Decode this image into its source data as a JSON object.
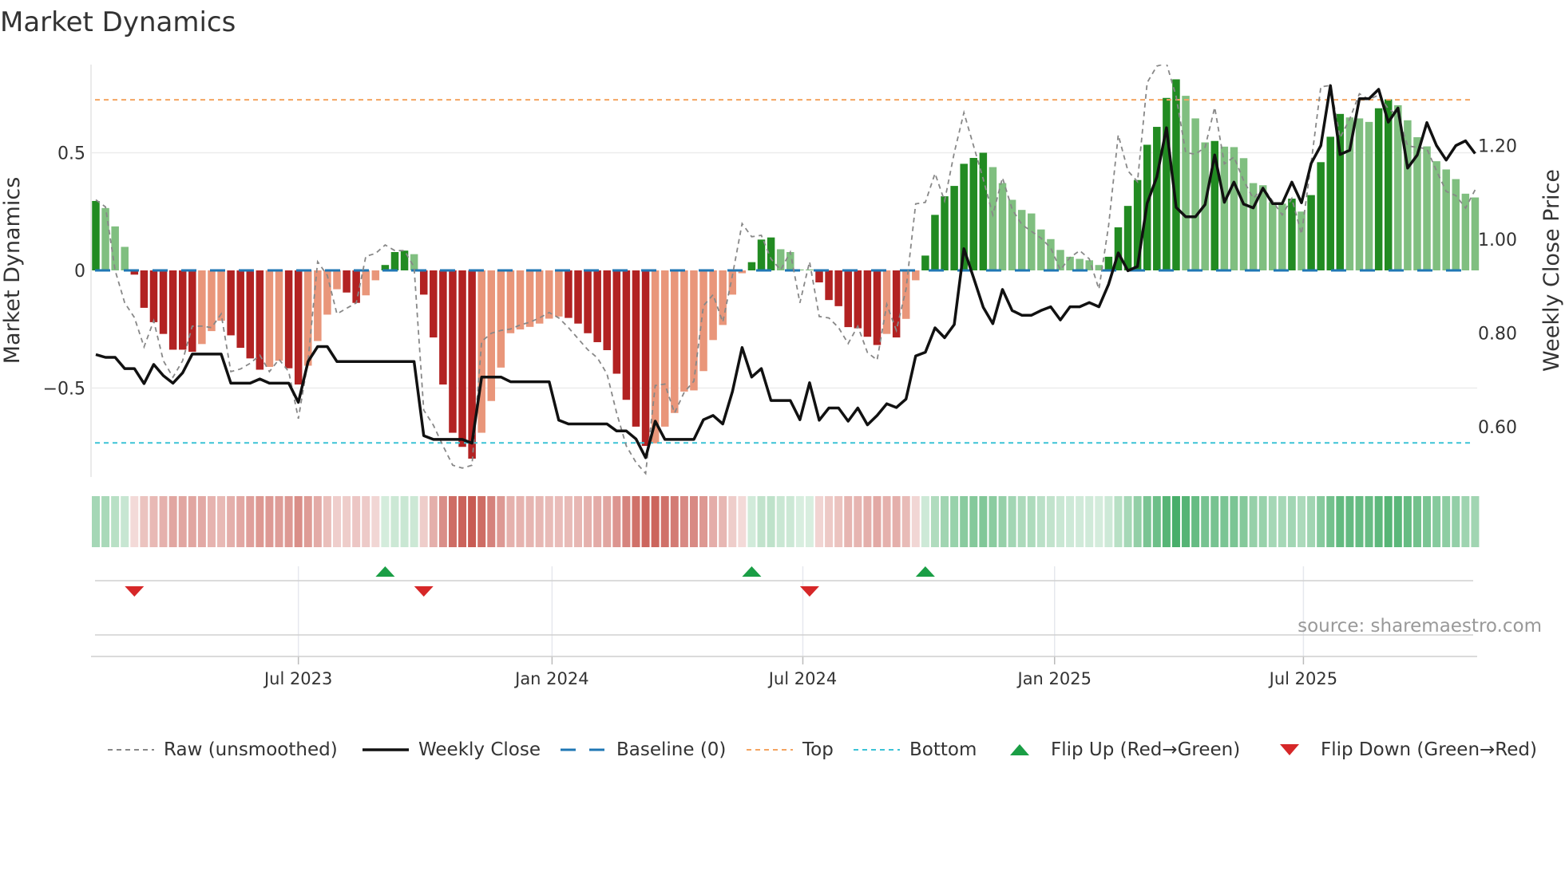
{
  "title": "Market Dynamics",
  "source": "source: sharemaestro.com",
  "colors": {
    "strong_green": "#228b22",
    "weak_green": "#80bf80",
    "strong_red": "#b22222",
    "weak_red": "#e9967a",
    "top": "#f4a460",
    "bottom": "#3cc3d6",
    "baseline": "#1f77b4",
    "raw": "#888888",
    "close": "#111111",
    "flip_up": "#1a9e45",
    "flip_down": "#d62728",
    "strip_green": [
      40,
      160,
      80
    ],
    "strip_red": [
      190,
      60,
      50
    ]
  },
  "chart_data": {
    "type": "bar",
    "title": "Market Dynamics",
    "ylabel": "Market Dynamics",
    "y2label": "Weekly Close Price",
    "ylim": [
      -0.878,
      0.875
    ],
    "y2lim": [
      0.494,
      1.372
    ],
    "grid": true,
    "yticks": [
      {
        "value": 0.5,
        "label": "0.5"
      },
      {
        "value": 0,
        "label": "0"
      },
      {
        "value": -0.5,
        "label": "−0.5"
      }
    ],
    "y2ticks": [
      {
        "value": 1.2,
        "label": "1.20"
      },
      {
        "value": 1.0,
        "label": "1.00"
      },
      {
        "value": 0.8,
        "label": "0.80"
      },
      {
        "value": 0.6,
        "label": "0.60"
      }
    ],
    "x_unit": "week index",
    "xticks": [
      {
        "week": 21,
        "label": "Jul 2023"
      },
      {
        "week": 47.3,
        "label": "Jan 2024"
      },
      {
        "week": 73.3,
        "label": "Jul 2024"
      },
      {
        "week": 99.4,
        "label": "Jan 2025"
      },
      {
        "week": 125.2,
        "label": "Jul 2025"
      }
    ],
    "top_level": 0.725,
    "bottom_level": -0.733,
    "baseline": 0,
    "bars": [
      0.295,
      0.265,
      0.187,
      0.1,
      -0.018,
      -0.159,
      -0.22,
      -0.27,
      -0.337,
      -0.337,
      -0.346,
      -0.313,
      -0.258,
      -0.214,
      -0.276,
      -0.329,
      -0.374,
      -0.422,
      -0.41,
      -0.384,
      -0.416,
      -0.485,
      -0.405,
      -0.3,
      -0.188,
      -0.08,
      -0.094,
      -0.138,
      -0.106,
      -0.042,
      0.023,
      0.078,
      0.084,
      0.069,
      -0.103,
      -0.285,
      -0.485,
      -0.69,
      -0.75,
      -0.8,
      -0.69,
      -0.555,
      -0.413,
      -0.267,
      -0.251,
      -0.24,
      -0.226,
      -0.205,
      -0.196,
      -0.202,
      -0.226,
      -0.267,
      -0.305,
      -0.339,
      -0.439,
      -0.55,
      -0.664,
      -0.746,
      -0.735,
      -0.664,
      -0.606,
      -0.515,
      -0.51,
      -0.428,
      -0.296,
      -0.232,
      -0.103,
      -0.012,
      0.035,
      0.131,
      0.14,
      0.09,
      0.078,
      0.004,
      0.004,
      -0.051,
      -0.126,
      -0.152,
      -0.241,
      -0.246,
      -0.282,
      -0.317,
      -0.27,
      -0.285,
      -0.206,
      -0.042,
      0.063,
      0.236,
      0.315,
      0.359,
      0.453,
      0.478,
      0.5,
      0.439,
      0.371,
      0.3,
      0.257,
      0.242,
      0.174,
      0.133,
      0.087,
      0.058,
      0.049,
      0.043,
      0.023,
      0.058,
      0.183,
      0.274,
      0.384,
      0.534,
      0.61,
      0.733,
      0.812,
      0.742,
      0.646,
      0.544,
      0.55,
      0.526,
      0.524,
      0.477,
      0.371,
      0.362,
      0.29,
      0.284,
      0.305,
      0.25,
      0.32,
      0.46,
      0.568,
      0.665,
      0.65,
      0.646,
      0.631,
      0.689,
      0.727,
      0.702,
      0.638,
      0.566,
      0.527,
      0.464,
      0.429,
      0.388,
      0.326,
      0.31
    ],
    "bar_strength": [
      "s",
      "w",
      "w",
      "w",
      "s",
      "s",
      "s",
      "s",
      "s",
      "s",
      "s",
      "w",
      "w",
      "w",
      "s",
      "s",
      "s",
      "s",
      "w",
      "w",
      "s",
      "s",
      "w",
      "w",
      "w",
      "w",
      "s",
      "s",
      "w",
      "w",
      "s",
      "s",
      "s",
      "w",
      "s",
      "s",
      "s",
      "s",
      "s",
      "s",
      "w",
      "w",
      "w",
      "w",
      "w",
      "w",
      "w",
      "w",
      "w",
      "s",
      "s",
      "s",
      "s",
      "s",
      "s",
      "s",
      "s",
      "s",
      "w",
      "w",
      "w",
      "w",
      "w",
      "w",
      "w",
      "w",
      "w",
      "w",
      "s",
      "s",
      "s",
      "w",
      "w",
      "w",
      "w",
      "s",
      "s",
      "s",
      "s",
      "s",
      "s",
      "s",
      "w",
      "s",
      "w",
      "w",
      "s",
      "s",
      "s",
      "s",
      "s",
      "s",
      "s",
      "w",
      "w",
      "w",
      "w",
      "w",
      "w",
      "w",
      "w",
      "w",
      "w",
      "w",
      "w",
      "s",
      "s",
      "s",
      "s",
      "s",
      "s",
      "s",
      "s",
      "w",
      "w",
      "w",
      "s",
      "w",
      "w",
      "w",
      "w",
      "w",
      "w",
      "w",
      "s",
      "w",
      "s",
      "s",
      "s",
      "s",
      "w",
      "w",
      "w",
      "s",
      "s",
      "w",
      "w",
      "w",
      "w",
      "w",
      "w",
      "w",
      "w",
      "w"
    ],
    "raw": [
      0.3,
      0.27,
      0.0,
      -0.138,
      -0.2,
      -0.325,
      -0.214,
      -0.384,
      -0.454,
      -0.384,
      -0.237,
      -0.237,
      -0.243,
      -0.185,
      -0.43,
      -0.419,
      -0.395,
      -0.36,
      -0.43,
      -0.378,
      -0.43,
      -0.63,
      -0.384,
      0.037,
      -0.021,
      -0.185,
      -0.161,
      -0.138,
      0.06,
      0.072,
      0.108,
      0.084,
      0.084,
      0.014,
      -0.594,
      -0.658,
      -0.746,
      -0.828,
      -0.84,
      -0.828,
      -0.302,
      -0.267,
      -0.255,
      -0.249,
      -0.232,
      -0.22,
      -0.202,
      -0.179,
      -0.202,
      -0.243,
      -0.29,
      -0.337,
      -0.372,
      -0.44,
      -0.606,
      -0.746,
      -0.816,
      -0.863,
      -0.489,
      -0.483,
      -0.606,
      -0.518,
      -0.471,
      -0.15,
      -0.103,
      -0.22,
      -0.021,
      0.199,
      0.143,
      0.149,
      0.049,
      0.002,
      0.078,
      -0.138,
      0.037,
      -0.196,
      -0.202,
      -0.243,
      -0.311,
      -0.237,
      -0.349,
      -0.381,
      -0.144,
      -0.255,
      -0.08,
      0.283,
      0.289,
      0.412,
      0.295,
      0.5,
      0.671,
      0.529,
      0.388,
      0.236,
      0.394,
      0.26,
      0.195,
      0.166,
      0.137,
      0.096,
      0.002,
      0.055,
      0.084,
      0.049,
      -0.08,
      0.19,
      0.576,
      0.423,
      0.377,
      0.798,
      0.868,
      0.88,
      0.739,
      0.5,
      0.494,
      0.523,
      0.693,
      0.453,
      0.482,
      0.382,
      0.306,
      0.353,
      0.295,
      0.236,
      0.306,
      0.154,
      0.458,
      0.78,
      0.786,
      0.564,
      0.643,
      0.751,
      0.727,
      0.745,
      0.687,
      0.658,
      0.529,
      0.523,
      0.517,
      0.423,
      0.336,
      0.318,
      0.265,
      0.342
    ],
    "weekly_close": [
      0.754,
      0.748,
      0.748,
      0.724,
      0.724,
      0.692,
      0.733,
      0.709,
      0.693,
      0.715,
      0.755,
      0.755,
      0.755,
      0.755,
      0.693,
      0.693,
      0.693,
      0.702,
      0.693,
      0.693,
      0.693,
      0.652,
      0.739,
      0.771,
      0.771,
      0.739,
      0.739,
      0.739,
      0.739,
      0.739,
      0.739,
      0.739,
      0.739,
      0.739,
      0.581,
      0.573,
      0.573,
      0.573,
      0.573,
      0.565,
      0.706,
      0.706,
      0.706,
      0.696,
      0.696,
      0.696,
      0.696,
      0.696,
      0.614,
      0.606,
      0.606,
      0.606,
      0.606,
      0.606,
      0.591,
      0.591,
      0.574,
      0.534,
      0.612,
      0.573,
      0.573,
      0.573,
      0.573,
      0.615,
      0.624,
      0.606,
      0.675,
      0.769,
      0.706,
      0.724,
      0.656,
      0.656,
      0.656,
      0.615,
      0.694,
      0.614,
      0.64,
      0.64,
      0.612,
      0.64,
      0.604,
      0.624,
      0.649,
      0.641,
      0.659,
      0.751,
      0.759,
      0.811,
      0.79,
      0.818,
      0.98,
      0.918,
      0.855,
      0.82,
      0.893,
      0.848,
      0.838,
      0.838,
      0.848,
      0.856,
      0.828,
      0.856,
      0.856,
      0.865,
      0.856,
      0.904,
      0.971,
      0.933,
      0.942,
      1.077,
      1.133,
      1.238,
      1.068,
      1.048,
      1.048,
      1.074,
      1.18,
      1.079,
      1.122,
      1.075,
      1.067,
      1.109,
      1.076,
      1.076,
      1.122,
      1.078,
      1.162,
      1.2,
      1.328,
      1.181,
      1.19,
      1.3,
      1.3,
      1.32,
      1.25,
      1.28,
      1.152,
      1.18,
      1.249,
      1.2,
      1.169,
      1.2,
      1.21,
      1.183
    ],
    "flips": [
      {
        "week": 4,
        "type": "down"
      },
      {
        "week": 30,
        "type": "up"
      },
      {
        "week": 34,
        "type": "down"
      },
      {
        "week": 68,
        "type": "up"
      },
      {
        "week": 74,
        "type": "down"
      },
      {
        "week": 86,
        "type": "up"
      }
    ],
    "legend": [
      {
        "key": "raw",
        "label": "Raw (unsmoothed)"
      },
      {
        "key": "close",
        "label": "Weekly Close"
      },
      {
        "key": "baseline",
        "label": "Baseline (0)"
      },
      {
        "key": "top",
        "label": "Top"
      },
      {
        "key": "bottom",
        "label": "Bottom"
      },
      {
        "key": "flip_up",
        "label": "Flip Up (Red→Green)"
      },
      {
        "key": "flip_down",
        "label": "Flip Down (Green→Red)"
      }
    ],
    "legend_position": "bottom"
  }
}
